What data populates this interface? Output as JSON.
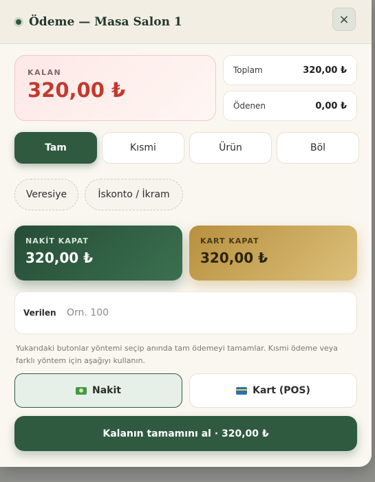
{
  "header": {
    "title": "Ödeme — Masa Salon 1",
    "close_symbol": "×"
  },
  "summary": {
    "kalan_label": "KALAN",
    "kalan_value": "320,00 ₺",
    "toplam_label": "Toplam",
    "toplam_value": "320,00 ₺",
    "odenen_label": "Ödenen",
    "odenen_value": "0,00 ₺"
  },
  "tabs": [
    {
      "label": "Tam",
      "active": true
    },
    {
      "label": "Kısmi",
      "active": false
    },
    {
      "label": "Ürün",
      "active": false
    },
    {
      "label": "Böl",
      "active": false
    }
  ],
  "options": {
    "veresiye": "Veresiye",
    "iskonto": "İskonto / İkram"
  },
  "quick": {
    "nakit_label": "NAKİT KAPAT",
    "nakit_value": "320,00 ₺",
    "kart_label": "KART KAPAT",
    "kart_value": "320,00 ₺"
  },
  "given": {
    "label": "Verilen",
    "placeholder": "Örn. 100",
    "value": ""
  },
  "hint": "Yukarıdaki butonlar yöntemi seçip anında tam ödemeyi tamamlar. Kısmi ödeme veya farklı yöntem için aşağıyı kullanın.",
  "methods": {
    "cash": "Nakit",
    "card": "Kart (POS)",
    "selected": "cash"
  },
  "final_button": "Kalanın tamamını al · 320,00 ₺",
  "colors": {
    "primary": "#2f5a40",
    "danger": "#c23a2c",
    "gold": "#c9a45a"
  }
}
